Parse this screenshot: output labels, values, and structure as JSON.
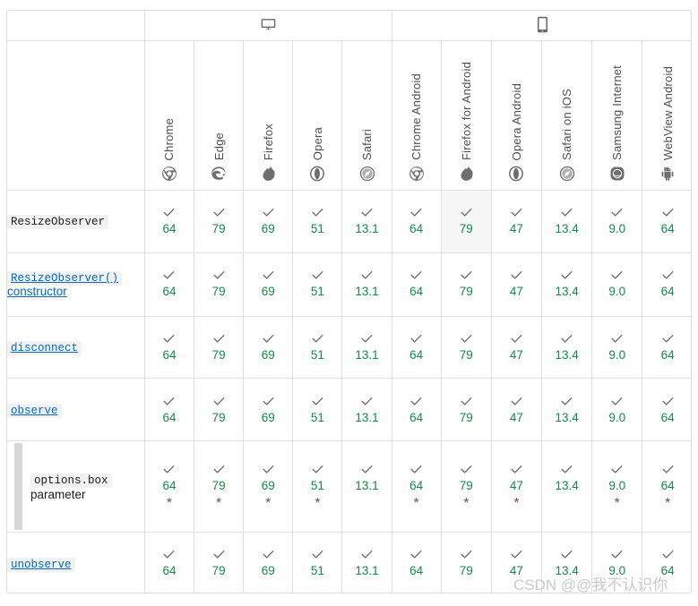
{
  "device_groups": [
    {
      "id": "desktop",
      "icon": "desktop-monitor-icon",
      "label": "desktop",
      "colspan": 5
    },
    {
      "id": "mobile",
      "icon": "mobile-phone-icon",
      "label": "mobile",
      "colspan": 6
    }
  ],
  "browsers": [
    {
      "key": "chrome",
      "name": "Chrome",
      "icon": "chrome-icon",
      "group": "desktop"
    },
    {
      "key": "edge",
      "name": "Edge",
      "icon": "edge-icon",
      "group": "desktop"
    },
    {
      "key": "firefox",
      "name": "Firefox",
      "icon": "firefox-icon",
      "group": "desktop"
    },
    {
      "key": "opera",
      "name": "Opera",
      "icon": "opera-icon",
      "group": "desktop"
    },
    {
      "key": "safari",
      "name": "Safari",
      "icon": "safari-icon",
      "group": "desktop"
    },
    {
      "key": "chrome_android",
      "name": "Chrome Android",
      "icon": "chrome-icon",
      "group": "mobile"
    },
    {
      "key": "firefox_android",
      "name": "Firefox for Android",
      "icon": "firefox-icon",
      "group": "mobile"
    },
    {
      "key": "opera_android",
      "name": "Opera Android",
      "icon": "opera-icon",
      "group": "mobile"
    },
    {
      "key": "safari_ios",
      "name": "Safari on iOS",
      "icon": "safari-icon",
      "group": "mobile"
    },
    {
      "key": "samsung",
      "name": "Samsung Internet",
      "icon": "samsung-internet-icon",
      "group": "mobile"
    },
    {
      "key": "webview",
      "name": "WebView Android",
      "icon": "android-robot-icon",
      "group": "mobile"
    }
  ],
  "rows": [
    {
      "id": "resizeobserver",
      "label": "ResizeObserver",
      "label_style": "code",
      "is_link": false,
      "indented": false,
      "suffix": "",
      "cells": [
        {
          "mark": "✓",
          "version": "64",
          "note": "",
          "highlight": false
        },
        {
          "mark": "✓",
          "version": "79",
          "note": "",
          "highlight": false
        },
        {
          "mark": "✓",
          "version": "69",
          "note": "",
          "highlight": false
        },
        {
          "mark": "✓",
          "version": "51",
          "note": "",
          "highlight": false
        },
        {
          "mark": "✓",
          "version": "13.1",
          "note": "",
          "highlight": false
        },
        {
          "mark": "✓",
          "version": "64",
          "note": "",
          "highlight": false
        },
        {
          "mark": "✓",
          "version": "79",
          "note": "",
          "highlight": true
        },
        {
          "mark": "✓",
          "version": "47",
          "note": "",
          "highlight": false
        },
        {
          "mark": "✓",
          "version": "13.4",
          "note": "",
          "highlight": false
        },
        {
          "mark": "✓",
          "version": "9.0",
          "note": "",
          "highlight": false
        },
        {
          "mark": "✓",
          "version": "64",
          "note": "",
          "highlight": false
        }
      ]
    },
    {
      "id": "resizeobserver-constructor",
      "label": "ResizeObserver()",
      "label_style": "code",
      "is_link": true,
      "indented": false,
      "suffix": "constructor",
      "cells": [
        {
          "mark": "✓",
          "version": "64",
          "note": "",
          "highlight": false
        },
        {
          "mark": "✓",
          "version": "79",
          "note": "",
          "highlight": false
        },
        {
          "mark": "✓",
          "version": "69",
          "note": "",
          "highlight": false
        },
        {
          "mark": "✓",
          "version": "51",
          "note": "",
          "highlight": false
        },
        {
          "mark": "✓",
          "version": "13.1",
          "note": "",
          "highlight": false
        },
        {
          "mark": "✓",
          "version": "64",
          "note": "",
          "highlight": false
        },
        {
          "mark": "✓",
          "version": "79",
          "note": "",
          "highlight": false
        },
        {
          "mark": "✓",
          "version": "47",
          "note": "",
          "highlight": false
        },
        {
          "mark": "✓",
          "version": "13.4",
          "note": "",
          "highlight": false
        },
        {
          "mark": "✓",
          "version": "9.0",
          "note": "",
          "highlight": false
        },
        {
          "mark": "✓",
          "version": "64",
          "note": "",
          "highlight": false
        }
      ]
    },
    {
      "id": "disconnect",
      "label": "disconnect",
      "label_style": "code",
      "is_link": true,
      "indented": false,
      "suffix": "",
      "cells": [
        {
          "mark": "✓",
          "version": "64",
          "note": "",
          "highlight": false
        },
        {
          "mark": "✓",
          "version": "79",
          "note": "",
          "highlight": false
        },
        {
          "mark": "✓",
          "version": "69",
          "note": "",
          "highlight": false
        },
        {
          "mark": "✓",
          "version": "51",
          "note": "",
          "highlight": false
        },
        {
          "mark": "✓",
          "version": "13.1",
          "note": "",
          "highlight": false
        },
        {
          "mark": "✓",
          "version": "64",
          "note": "",
          "highlight": false
        },
        {
          "mark": "✓",
          "version": "79",
          "note": "",
          "highlight": false
        },
        {
          "mark": "✓",
          "version": "47",
          "note": "",
          "highlight": false
        },
        {
          "mark": "✓",
          "version": "13.4",
          "note": "",
          "highlight": false
        },
        {
          "mark": "✓",
          "version": "9.0",
          "note": "",
          "highlight": false
        },
        {
          "mark": "✓",
          "version": "64",
          "note": "",
          "highlight": false
        }
      ]
    },
    {
      "id": "observe",
      "label": "observe",
      "label_style": "code",
      "is_link": true,
      "indented": false,
      "suffix": "",
      "cells": [
        {
          "mark": "✓",
          "version": "64",
          "note": "",
          "highlight": false
        },
        {
          "mark": "✓",
          "version": "79",
          "note": "",
          "highlight": false
        },
        {
          "mark": "✓",
          "version": "69",
          "note": "",
          "highlight": false
        },
        {
          "mark": "✓",
          "version": "51",
          "note": "",
          "highlight": false
        },
        {
          "mark": "✓",
          "version": "13.1",
          "note": "",
          "highlight": false
        },
        {
          "mark": "✓",
          "version": "64",
          "note": "",
          "highlight": false
        },
        {
          "mark": "✓",
          "version": "79",
          "note": "",
          "highlight": false
        },
        {
          "mark": "✓",
          "version": "47",
          "note": "",
          "highlight": false
        },
        {
          "mark": "✓",
          "version": "13.4",
          "note": "",
          "highlight": false
        },
        {
          "mark": "✓",
          "version": "9.0",
          "note": "",
          "highlight": false
        },
        {
          "mark": "✓",
          "version": "64",
          "note": "",
          "highlight": false
        }
      ]
    },
    {
      "id": "options-box-parameter",
      "label": "options.box",
      "label_style": "code",
      "is_link": false,
      "indented": true,
      "suffix": "parameter",
      "cells": [
        {
          "mark": "✓",
          "version": "64",
          "note": "*",
          "highlight": false
        },
        {
          "mark": "✓",
          "version": "79",
          "note": "*",
          "highlight": false
        },
        {
          "mark": "✓",
          "version": "69",
          "note": "*",
          "highlight": false
        },
        {
          "mark": "✓",
          "version": "51",
          "note": "*",
          "highlight": false
        },
        {
          "mark": "✓",
          "version": "13.1",
          "note": "",
          "highlight": false
        },
        {
          "mark": "✓",
          "version": "64",
          "note": "*",
          "highlight": false
        },
        {
          "mark": "✓",
          "version": "79",
          "note": "*",
          "highlight": false
        },
        {
          "mark": "✓",
          "version": "47",
          "note": "*",
          "highlight": false
        },
        {
          "mark": "✓",
          "version": "13.4",
          "note": "",
          "highlight": false
        },
        {
          "mark": "✓",
          "version": "9.0",
          "note": "*",
          "highlight": false
        },
        {
          "mark": "✓",
          "version": "64",
          "note": "*",
          "highlight": false
        }
      ]
    },
    {
      "id": "unobserve",
      "label": "unobserve",
      "label_style": "code",
      "is_link": true,
      "indented": false,
      "suffix": "",
      "cells": [
        {
          "mark": "✓",
          "version": "64",
          "note": "",
          "highlight": false
        },
        {
          "mark": "✓",
          "version": "79",
          "note": "",
          "highlight": false
        },
        {
          "mark": "✓",
          "version": "69",
          "note": "",
          "highlight": false
        },
        {
          "mark": "✓",
          "version": "51",
          "note": "",
          "highlight": false
        },
        {
          "mark": "✓",
          "version": "13.1",
          "note": "",
          "highlight": false
        },
        {
          "mark": "✓",
          "version": "64",
          "note": "",
          "highlight": false
        },
        {
          "mark": "✓",
          "version": "79",
          "note": "",
          "highlight": false
        },
        {
          "mark": "✓",
          "version": "47",
          "note": "",
          "highlight": false
        },
        {
          "mark": "✓",
          "version": "13.4",
          "note": "",
          "highlight": false
        },
        {
          "mark": "✓",
          "version": "9.0",
          "note": "",
          "highlight": false
        },
        {
          "mark": "✓",
          "version": "64",
          "note": "",
          "highlight": false
        }
      ]
    }
  ],
  "watermark": {
    "text": "CSDN @@我不认识你"
  },
  "colors": {
    "version_green": "#138a46",
    "link_blue": "#0069c2",
    "tick_gray": "#6f6f6f",
    "border_gray": "#e0e0e0",
    "highlight_bg": "#f7f7f8"
  }
}
